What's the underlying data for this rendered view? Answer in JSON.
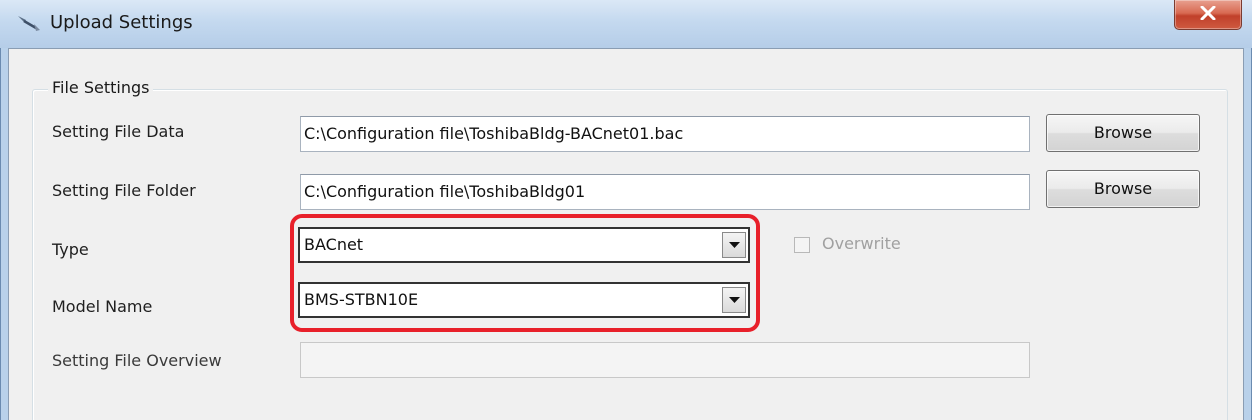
{
  "window": {
    "title": "Upload Settings",
    "close_label": "x"
  },
  "file_settings": {
    "group_title": "File Settings",
    "setting_file_data": {
      "label": "Setting File Data",
      "value": "C:\\Configuration file\\ToshibaBldg-BACnet01.bac",
      "browse_label": "Browse"
    },
    "setting_file_folder": {
      "label": "Setting File Folder",
      "value": "C:\\Configuration file\\ToshibaBldg01",
      "browse_label": "Browse"
    },
    "type": {
      "label": "Type",
      "selected": "BACnet"
    },
    "overwrite": {
      "label": "Overwrite",
      "checked": false,
      "enabled": false
    },
    "model_name": {
      "label": "Model Name",
      "selected": "BMS-STBN10E"
    },
    "setting_file_overview": {
      "label": "Setting File Overview",
      "value": ""
    }
  },
  "colors": {
    "highlight": "#e8202a",
    "titlebar": "#c4d9ef",
    "close_button": "#c0402a"
  },
  "icons": {
    "title": "wrench-icon",
    "close": "close-icon",
    "dropdown": "chevron-down-icon"
  }
}
